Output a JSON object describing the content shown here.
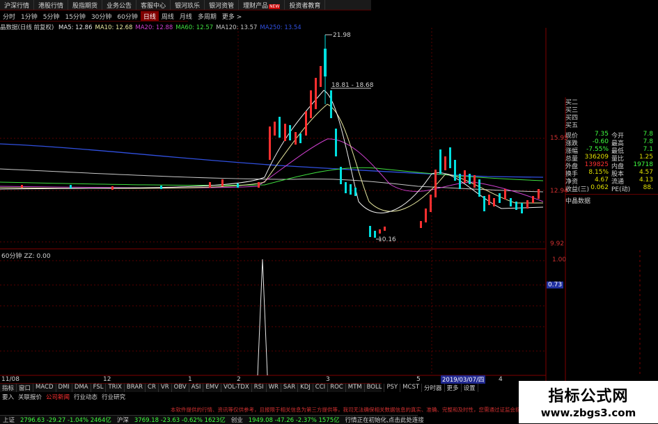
{
  "nav": [
    {
      "label": "沪深行情",
      "badge": ""
    },
    {
      "label": "港股行情",
      "badge": ""
    },
    {
      "label": "股指期货",
      "badge": ""
    },
    {
      "label": "业务公告",
      "badge": ""
    },
    {
      "label": "客服中心",
      "badge": ""
    },
    {
      "label": "银河玖乐",
      "badge": ""
    },
    {
      "label": "银河资管",
      "badge": ""
    },
    {
      "label": "理财产品",
      "badge": "NEW"
    },
    {
      "label": "投资者教育",
      "badge": ""
    }
  ],
  "periods": [
    "分时",
    "1分钟",
    "5分钟",
    "15分钟",
    "30分钟",
    "60分钟",
    "日线",
    "周线",
    "月线",
    "多周期",
    "更多 >"
  ],
  "active_period": 6,
  "chart_title": "晶数据(日线 前复权)",
  "ma_legend": [
    {
      "text": "MA5: 12.86",
      "color": "#e8e8e8"
    },
    {
      "text": "MA10: 12.68",
      "color": "#e8e8a0"
    },
    {
      "text": "MA20: 12.88",
      "color": "#d040d0"
    },
    {
      "text": "MA60: 12.57",
      "color": "#40e040"
    },
    {
      "text": "MA120: 13.57",
      "color": "#c8c8c8"
    },
    {
      "text": "MA250: 13.54",
      "color": "#3050e0"
    }
  ],
  "annotations": {
    "high": "21.98",
    "range": "18.81 - 18.68",
    "low": "10.16"
  },
  "price_axis": [
    "15.95",
    "12.94",
    "9.92"
  ],
  "indicator_title": "60分钟 ZZ: 0.00",
  "indicator_axis": [
    "1.00",
    "0.73"
  ],
  "x_labels": [
    "11/08",
    "12",
    "1",
    "2",
    "3",
    "5",
    "4"
  ],
  "date_box": "2019/03/07/四",
  "quote": {
    "book": [
      "买二",
      "买三",
      "买四",
      "买五"
    ],
    "rows": [
      {
        "k": "现价",
        "v1": "7.35",
        "k2": "今开",
        "v2": "7.8",
        "c1": "#40ff40",
        "c2": "#40ff40"
      },
      {
        "k": "涨跌",
        "v1": "-0.60",
        "k2": "最高",
        "v2": "7.8",
        "c1": "#40ff40",
        "c2": "#40ff40"
      },
      {
        "k": "涨幅",
        "v1": "-7.55%",
        "k2": "最低",
        "v2": "7.1",
        "c1": "#40ff40",
        "c2": "#40ff40"
      },
      {
        "k": "总量",
        "v1": "336209",
        "k2": "量比",
        "v2": "1.25",
        "c1": "#e0e000",
        "c2": "#e0e000"
      },
      {
        "k": "外盘",
        "v1": "139825",
        "k2": "内盘",
        "v2": "19718",
        "c1": "#ff3030",
        "c2": "#40ff40"
      },
      {
        "k": "换手",
        "v1": "8.15%",
        "k2": "股本",
        "v2": "4.57",
        "c1": "#e0e000",
        "c2": "#e0e000"
      },
      {
        "k": "净资",
        "v1": "4.67",
        "k2": "流通",
        "v2": "4.13",
        "c1": "#e0e000",
        "c2": "#e0e000"
      },
      {
        "k": "收益(三)",
        "v1": "0.062",
        "k2": "PE(动)",
        "v2": "88.",
        "c1": "#e0e000",
        "c2": "#e0e000"
      }
    ],
    "tab": "中晶数据"
  },
  "indicators": [
    "指标",
    "窗口",
    "MACD",
    "DMI",
    "DMA",
    "FSL",
    "TRIX",
    "BRAR",
    "CR",
    "VR",
    "OBV",
    "ASI",
    "EMV",
    "VOL-TDX",
    "RSI",
    "WR",
    "SAR",
    "KDJ",
    "CCI",
    "ROC",
    "MTM",
    "BOLL",
    "PSY",
    "MCST",
    "分时器",
    "更多",
    "设置"
  ],
  "func_tabs": [
    "要入",
    "关联报价",
    "公司新闻",
    "行业动态",
    "行业研究"
  ],
  "notice": "本软件提供的行情、资讯等仅供参考，且报限于相关信息为第三方提供等，我司无法确保相关数据信息的真实、准确、完整和及时性，您需通过证监会指定",
  "status": [
    {
      "text": "上证",
      "color": "#d0d0d0"
    },
    {
      "text": "2796.63 -29.27 -1.04% 2464亿",
      "color": "#40ff40"
    },
    {
      "text": "沪深",
      "color": "#d0d0d0"
    },
    {
      "text": "3769.18 -23.63 -0.62% 1623亿",
      "color": "#40ff40"
    },
    {
      "text": "创业",
      "color": "#d0d0d0"
    },
    {
      "text": "1949.08 -47.26 -2.37% 1575亿",
      "color": "#40ff40"
    },
    {
      "text": "行情正在初始化,点击此处连接",
      "color": "#d0d0d0"
    }
  ],
  "watermark": {
    "title": "指标公式网",
    "url": "www.zbgs3.com"
  }
}
